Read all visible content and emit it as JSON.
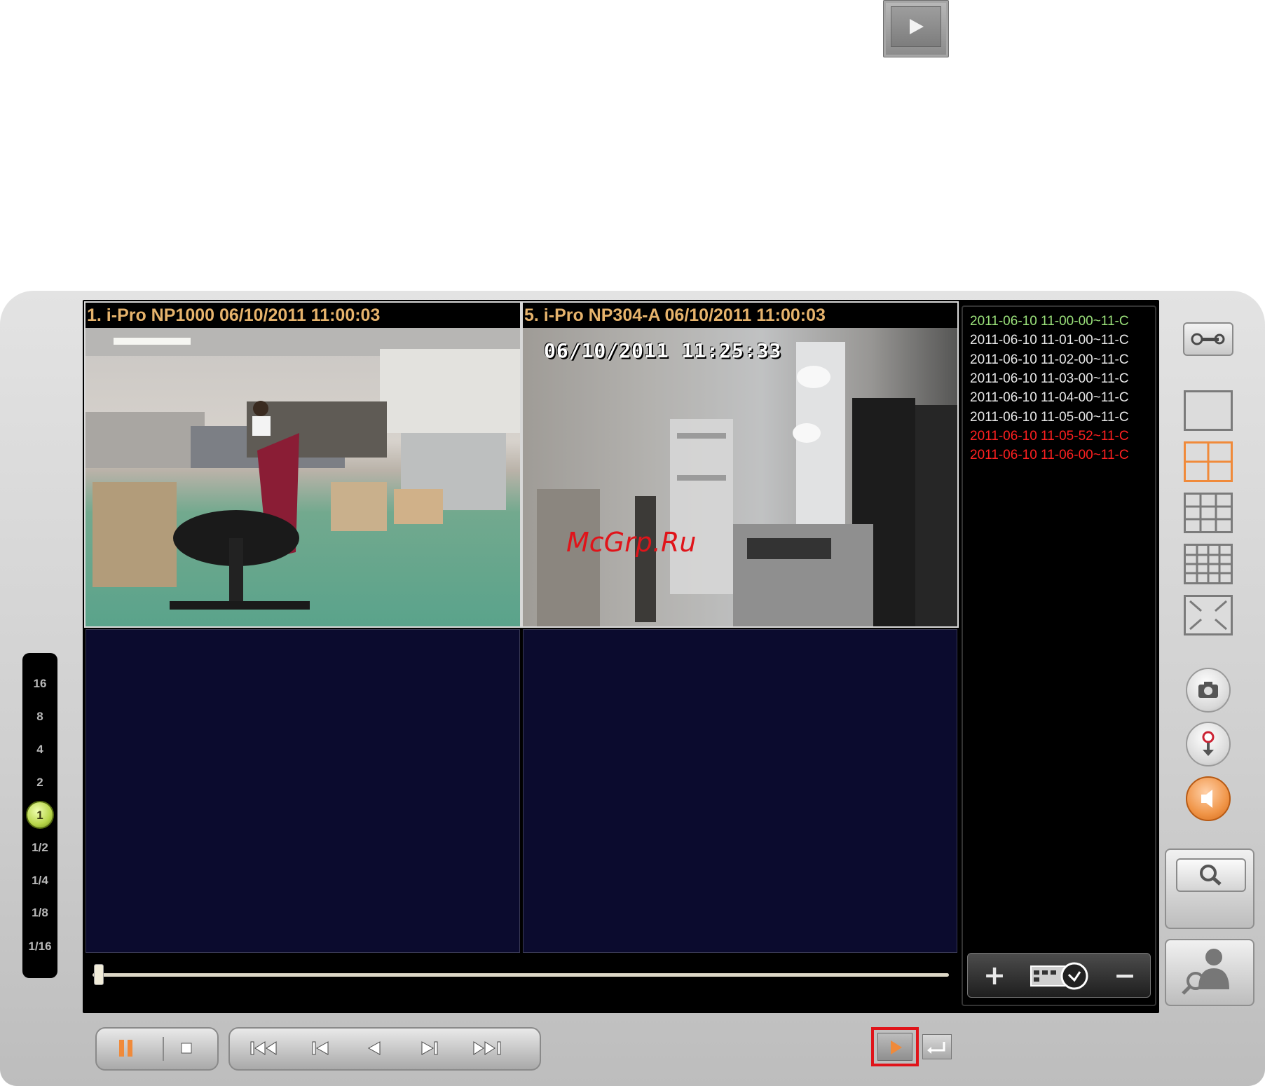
{
  "top_button": {
    "icon": "play-icon"
  },
  "cameras": [
    {
      "title": "1. i-Pro NP1000 06/10/2011 11:00:03"
    },
    {
      "title": "5. i-Pro NP304-A 06/10/2011 11:00:03",
      "osd": "06/10/2011 11:25:33"
    }
  ],
  "watermark": "McGrp.Ru",
  "file_list": [
    {
      "label": "2011-06-10 11-00-00~11-C",
      "color": "#9be27b"
    },
    {
      "label": "2011-06-10 11-01-00~11-C",
      "color": "#e8e8e8"
    },
    {
      "label": "2011-06-10 11-02-00~11-C",
      "color": "#e8e8e8"
    },
    {
      "label": "2011-06-10 11-03-00~11-C",
      "color": "#e8e8e8"
    },
    {
      "label": "2011-06-10 11-04-00~11-C",
      "color": "#e8e8e8"
    },
    {
      "label": "2011-06-10 11-05-00~11-C",
      "color": "#e8e8e8"
    },
    {
      "label": "2011-06-10 11-05-52~11-C",
      "color": "#ff2020"
    },
    {
      "label": "2011-06-10 11-06-00~11-C",
      "color": "#ff2020"
    }
  ],
  "list_tools": {
    "add": "+",
    "remove": "−"
  },
  "speeds": [
    "16",
    "8",
    "4",
    "2",
    "1",
    "1/2",
    "1/4",
    "1/8",
    "1/16"
  ],
  "speed_selected": "1",
  "progress": 0.0,
  "right_panel": {
    "settings_icon": "wrench-icon",
    "layouts": [
      "layout-1-icon",
      "layout-4-icon",
      "layout-9-icon",
      "layout-16-icon",
      "fullscreen-icon"
    ],
    "active_layout": "layout-4-icon",
    "snapshot_icon": "camera-icon",
    "record_icon": "record-download-icon",
    "audio_icon": "speaker-icon",
    "search_icon": "magnifier-icon",
    "people_search_icon": "person-search-icon"
  },
  "bottom_controls": {
    "pause": "pause-icon",
    "stop": "stop-icon",
    "first": "skip-first-icon",
    "prev": "step-back-icon",
    "reverse": "reverse-play-icon",
    "next": "step-forward-icon",
    "last": "skip-last-icon",
    "play_selected": "play-icon",
    "return": "return-icon"
  },
  "colors": {
    "accent": "#f08a3a",
    "highlight_box": "#e0141a",
    "empty_tile": "#0b0b2e",
    "title_text": "#e6b36c"
  }
}
